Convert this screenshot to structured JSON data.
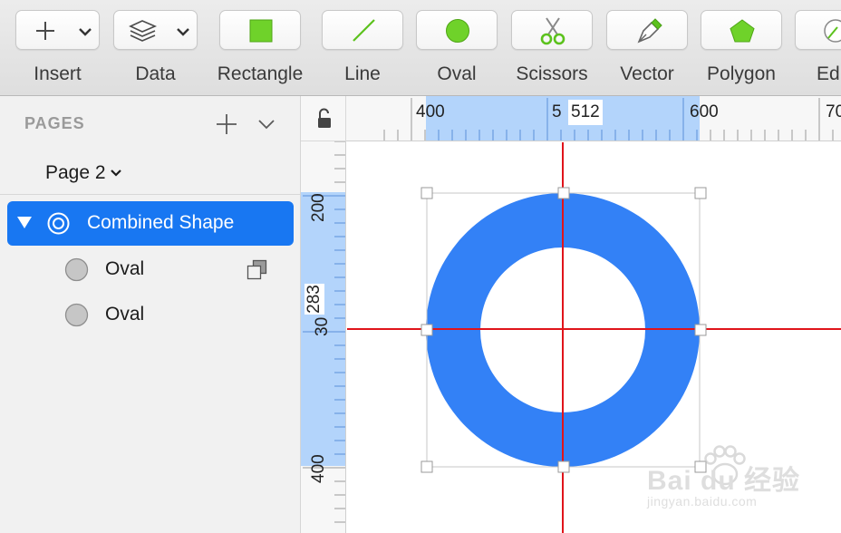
{
  "toolbar": {
    "insert_label": "Insert",
    "data_label": "Data",
    "rectangle_label": "Rectangle",
    "line_label": "Line",
    "oval_label": "Oval",
    "scissors_label": "Scissors",
    "vector_label": "Vector",
    "polygon_label": "Polygon",
    "edit_label": "Ed"
  },
  "sidebar": {
    "pages_title": "PAGES",
    "current_page": "Page 2",
    "layers": [
      {
        "name": "Combined Shape",
        "icon": "combined-shape-icon",
        "selected": true
      },
      {
        "name": "Oval",
        "icon": "oval-layer-icon",
        "selected": false
      },
      {
        "name": "Oval",
        "icon": "oval-layer-icon",
        "selected": false
      }
    ]
  },
  "rulers": {
    "h_labels": {
      "l400": "400",
      "l500": "5",
      "l600": "600",
      "l700": "70",
      "cursor": "512"
    },
    "v_labels": {
      "l200": "200",
      "l300": "30",
      "l400": "400",
      "cursor": "283"
    }
  },
  "colors": {
    "shape_fill": "#3381f6",
    "guide": "#e0141b",
    "selection_accent": "#1877f2",
    "ruler_highlight": "#b3d4fb"
  },
  "watermark": {
    "brand": "Bai du 经验",
    "url": "jingyan.baidu.com"
  }
}
